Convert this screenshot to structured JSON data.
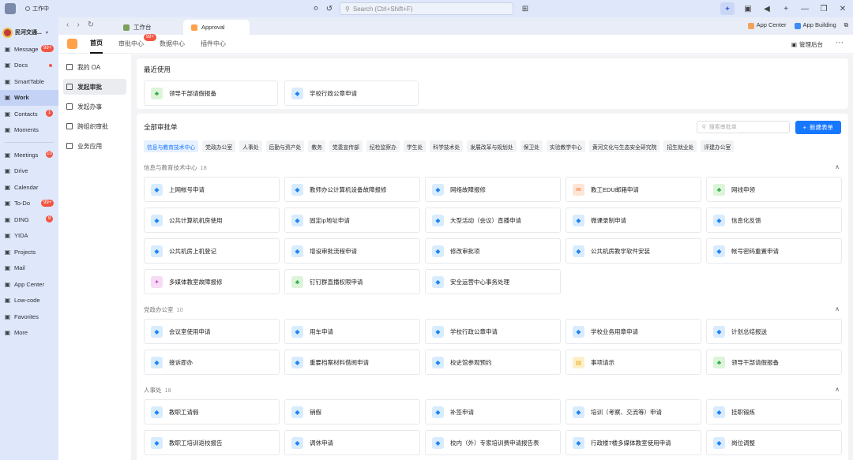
{
  "titlebar": {
    "status": "工作中",
    "search_placeholder": "Search (Ctrl+Shift+F)"
  },
  "sidebar": {
    "org_name": "民河交通...",
    "items": [
      {
        "label": "Message",
        "icon": "message-icon",
        "badge": "99+"
      },
      {
        "label": "Docs",
        "icon": "docs-icon",
        "dot": true
      },
      {
        "label": "SmartTable",
        "icon": "smarttable-icon"
      },
      {
        "label": "Work",
        "icon": "grid-icon",
        "active": true
      },
      {
        "label": "Contacts",
        "icon": "contacts-icon",
        "badge": "1"
      },
      {
        "label": "Moments",
        "icon": "moments-icon"
      }
    ],
    "items2": [
      {
        "label": "Meetings",
        "icon": "video-icon",
        "badge": "10"
      },
      {
        "label": "Drive",
        "icon": "drive-icon"
      },
      {
        "label": "Calendar",
        "icon": "calendar-icon"
      },
      {
        "label": "To-Do",
        "icon": "todo-icon",
        "badge": "99+"
      },
      {
        "label": "DING",
        "icon": "ding-icon",
        "badge": "9"
      },
      {
        "label": "YIDA",
        "icon": "yida-icon"
      },
      {
        "label": "Projects",
        "icon": "projects-icon"
      },
      {
        "label": "Mail",
        "icon": "mail-icon"
      },
      {
        "label": "App Center",
        "icon": "app-center-icon"
      },
      {
        "label": "Low-code",
        "icon": "low-code-icon"
      },
      {
        "label": "Favorites",
        "icon": "favorites-icon"
      },
      {
        "label": "More",
        "icon": "more-icon"
      }
    ]
  },
  "tabs": {
    "tab1": "工作台",
    "tab2": "Approval",
    "app_center": "App Center",
    "app_building": "App Building"
  },
  "topnav": {
    "home": "首页",
    "approval_center": "审批中心",
    "approval_badge": "99+",
    "data_center": "数据中心",
    "plugin_center": "插件中心",
    "admin": "管理后台"
  },
  "leftnav": [
    "我的 OA",
    "发起审批",
    "发起办事",
    "跨组织审批",
    "业务应用"
  ],
  "recent": {
    "title": "最近使用",
    "items": [
      {
        "label": "领导干部请假报备",
        "color": "green"
      },
      {
        "label": "学校行政公章申请",
        "color": "blue"
      }
    ]
  },
  "all": {
    "title": "全部审批单",
    "search_placeholder": "搜索审批单",
    "new_button": "新建表单",
    "chips": [
      "信息与教育技术中心",
      "党政办公室",
      "人事处",
      "后勤与资产处",
      "教务",
      "党委宣传部",
      "纪检监察办",
      "学生处",
      "科学技术处",
      "发展改革与规划处",
      "保卫处",
      "实验教学中心",
      "黄河文化与生态安全研究院",
      "招生就业处",
      "评建办公室"
    ],
    "groups": [
      {
        "name": "信息与教育技术中心",
        "count": "18",
        "forms": [
          {
            "label": "上网帐号申请",
            "color": "blue"
          },
          {
            "label": "教师办公计算机设备故障报修",
            "color": "blue"
          },
          {
            "label": "网络故障报修",
            "color": "blue"
          },
          {
            "label": "教工EDU邮箱申请",
            "color": "orange"
          },
          {
            "label": "网线申领",
            "color": "green"
          },
          {
            "label": "公共计算机机房使用",
            "color": "blue"
          },
          {
            "label": "固定ip地址申请",
            "color": "blue"
          },
          {
            "label": "大型活动（会议）直播申请",
            "color": "blue"
          },
          {
            "label": "微课录制申请",
            "color": "blue"
          },
          {
            "label": "信息化反馈",
            "color": "blue"
          },
          {
            "label": "公共机房上机登记",
            "color": "blue"
          },
          {
            "label": "增设审批流程申请",
            "color": "blue"
          },
          {
            "label": "修改审批项",
            "color": "blue"
          },
          {
            "label": "公共机房教学软件安装",
            "color": "blue"
          },
          {
            "label": "帐号密码重置申请",
            "color": "blue"
          },
          {
            "label": "多媒体教室故障报修",
            "color": "pink"
          },
          {
            "label": "钉钉群直播权限申请",
            "color": "green"
          },
          {
            "label": "安全运营中心事务处理",
            "color": "blue"
          }
        ]
      },
      {
        "name": "党政办公室",
        "count": "10",
        "forms": [
          {
            "label": "会议室使用申请",
            "color": "blue"
          },
          {
            "label": "用车申请",
            "color": "blue"
          },
          {
            "label": "学校行政公章申请",
            "color": "blue"
          },
          {
            "label": "学校业务用章申请",
            "color": "blue"
          },
          {
            "label": "计划总结报送",
            "color": "blue"
          },
          {
            "label": "接诉即办",
            "color": "blue"
          },
          {
            "label": "重要档案材料借阅申请",
            "color": "blue"
          },
          {
            "label": "校史馆参观预约",
            "color": "blue"
          },
          {
            "label": "事项请示",
            "color": "yellow"
          },
          {
            "label": "领导干部请假报备",
            "color": "green"
          }
        ]
      },
      {
        "name": "人事处",
        "count": "18",
        "forms": [
          {
            "label": "教职工请假",
            "color": "blue"
          },
          {
            "label": "销假",
            "color": "blue"
          },
          {
            "label": "补签申请",
            "color": "blue"
          },
          {
            "label": "培训（考察、交流等）申请",
            "color": "blue"
          },
          {
            "label": "挂职锻炼",
            "color": "blue"
          },
          {
            "label": "教职工培训返校报告",
            "color": "blue"
          },
          {
            "label": "调休申请",
            "color": "blue"
          },
          {
            "label": "校内（外）专家培训费申请报告表",
            "color": "blue"
          },
          {
            "label": "行政楼7楼多媒体教室使用申请",
            "color": "blue"
          },
          {
            "label": "岗位调整",
            "color": "blue"
          }
        ]
      }
    ]
  },
  "colors": {
    "accent": "#1677ff",
    "badge": "#f25643",
    "sidebar_bg": "#dfe7fb"
  }
}
